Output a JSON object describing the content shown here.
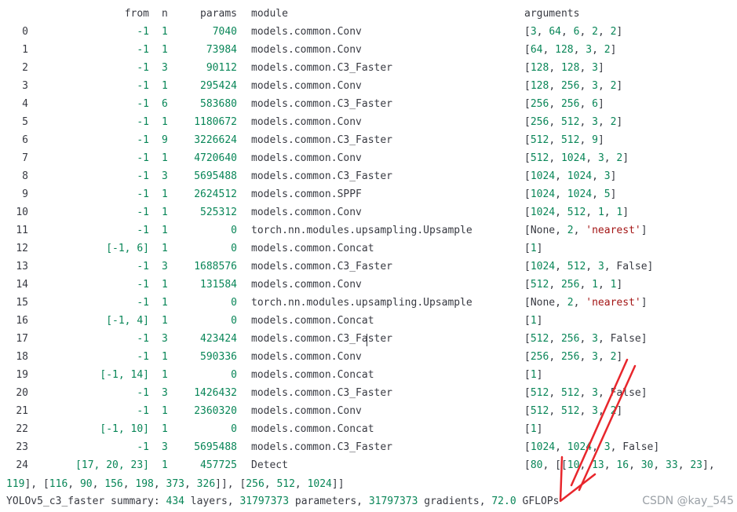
{
  "header": {
    "from": "from",
    "n": "n",
    "params": "params",
    "module": "module",
    "arguments": "arguments"
  },
  "rows": [
    {
      "idx": "0",
      "from": "-1",
      "n": "1",
      "params": "7040",
      "module": "models.common.Conv",
      "args": [
        [
          "[",
          "p"
        ],
        [
          "3",
          "n"
        ],
        [
          ", ",
          "p"
        ],
        [
          "64",
          "n"
        ],
        [
          ", ",
          "p"
        ],
        [
          "6",
          "n"
        ],
        [
          ", ",
          "p"
        ],
        [
          "2",
          "n"
        ],
        [
          ", ",
          "p"
        ],
        [
          "2",
          "n"
        ],
        [
          "]",
          "p"
        ]
      ]
    },
    {
      "idx": "1",
      "from": "-1",
      "n": "1",
      "params": "73984",
      "module": "models.common.Conv",
      "args": [
        [
          "[",
          "p"
        ],
        [
          "64",
          "n"
        ],
        [
          ", ",
          "p"
        ],
        [
          "128",
          "n"
        ],
        [
          ", ",
          "p"
        ],
        [
          "3",
          "n"
        ],
        [
          ", ",
          "p"
        ],
        [
          "2",
          "n"
        ],
        [
          "]",
          "p"
        ]
      ]
    },
    {
      "idx": "2",
      "from": "-1",
      "n": "3",
      "params": "90112",
      "module": "models.common.C3_Faster",
      "args": [
        [
          "[",
          "p"
        ],
        [
          "128",
          "n"
        ],
        [
          ", ",
          "p"
        ],
        [
          "128",
          "n"
        ],
        [
          ", ",
          "p"
        ],
        [
          "3",
          "n"
        ],
        [
          "]",
          "p"
        ]
      ]
    },
    {
      "idx": "3",
      "from": "-1",
      "n": "1",
      "params": "295424",
      "module": "models.common.Conv",
      "args": [
        [
          "[",
          "p"
        ],
        [
          "128",
          "n"
        ],
        [
          ", ",
          "p"
        ],
        [
          "256",
          "n"
        ],
        [
          ", ",
          "p"
        ],
        [
          "3",
          "n"
        ],
        [
          ", ",
          "p"
        ],
        [
          "2",
          "n"
        ],
        [
          "]",
          "p"
        ]
      ]
    },
    {
      "idx": "4",
      "from": "-1",
      "n": "6",
      "params": "583680",
      "module": "models.common.C3_Faster",
      "args": [
        [
          "[",
          "p"
        ],
        [
          "256",
          "n"
        ],
        [
          ", ",
          "p"
        ],
        [
          "256",
          "n"
        ],
        [
          ", ",
          "p"
        ],
        [
          "6",
          "n"
        ],
        [
          "]",
          "p"
        ]
      ]
    },
    {
      "idx": "5",
      "from": "-1",
      "n": "1",
      "params": "1180672",
      "module": "models.common.Conv",
      "args": [
        [
          "[",
          "p"
        ],
        [
          "256",
          "n"
        ],
        [
          ", ",
          "p"
        ],
        [
          "512",
          "n"
        ],
        [
          ", ",
          "p"
        ],
        [
          "3",
          "n"
        ],
        [
          ", ",
          "p"
        ],
        [
          "2",
          "n"
        ],
        [
          "]",
          "p"
        ]
      ]
    },
    {
      "idx": "6",
      "from": "-1",
      "n": "9",
      "params": "3226624",
      "module": "models.common.C3_Faster",
      "args": [
        [
          "[",
          "p"
        ],
        [
          "512",
          "n"
        ],
        [
          ", ",
          "p"
        ],
        [
          "512",
          "n"
        ],
        [
          ", ",
          "p"
        ],
        [
          "9",
          "n"
        ],
        [
          "]",
          "p"
        ]
      ]
    },
    {
      "idx": "7",
      "from": "-1",
      "n": "1",
      "params": "4720640",
      "module": "models.common.Conv",
      "args": [
        [
          "[",
          "p"
        ],
        [
          "512",
          "n"
        ],
        [
          ", ",
          "p"
        ],
        [
          "1024",
          "n"
        ],
        [
          ", ",
          "p"
        ],
        [
          "3",
          "n"
        ],
        [
          ", ",
          "p"
        ],
        [
          "2",
          "n"
        ],
        [
          "]",
          "p"
        ]
      ]
    },
    {
      "idx": "8",
      "from": "-1",
      "n": "3",
      "params": "5695488",
      "module": "models.common.C3_Faster",
      "args": [
        [
          "[",
          "p"
        ],
        [
          "1024",
          "n"
        ],
        [
          ", ",
          "p"
        ],
        [
          "1024",
          "n"
        ],
        [
          ", ",
          "p"
        ],
        [
          "3",
          "n"
        ],
        [
          "]",
          "p"
        ]
      ]
    },
    {
      "idx": "9",
      "from": "-1",
      "n": "1",
      "params": "2624512",
      "module": "models.common.SPPF",
      "args": [
        [
          "[",
          "p"
        ],
        [
          "1024",
          "n"
        ],
        [
          ", ",
          "p"
        ],
        [
          "1024",
          "n"
        ],
        [
          ", ",
          "p"
        ],
        [
          "5",
          "n"
        ],
        [
          "]",
          "p"
        ]
      ]
    },
    {
      "idx": "10",
      "from": "-1",
      "n": "1",
      "params": "525312",
      "module": "models.common.Conv",
      "args": [
        [
          "[",
          "p"
        ],
        [
          "1024",
          "n"
        ],
        [
          ", ",
          "p"
        ],
        [
          "512",
          "n"
        ],
        [
          ", ",
          "p"
        ],
        [
          "1",
          "n"
        ],
        [
          ", ",
          "p"
        ],
        [
          "1",
          "n"
        ],
        [
          "]",
          "p"
        ]
      ]
    },
    {
      "idx": "11",
      "from": "-1",
      "n": "1",
      "params": "0",
      "module": "torch.nn.modules.upsampling.Upsample",
      "args": [
        [
          "[None, ",
          "p"
        ],
        [
          "2",
          "n"
        ],
        [
          ", ",
          "p"
        ],
        [
          "'nearest'",
          "s"
        ],
        [
          "]",
          "p"
        ]
      ]
    },
    {
      "idx": "12",
      "from": "[-1, 6]",
      "n": "1",
      "params": "0",
      "module": "models.common.Concat",
      "args": [
        [
          "[",
          "p"
        ],
        [
          "1",
          "n"
        ],
        [
          "]",
          "p"
        ]
      ]
    },
    {
      "idx": "13",
      "from": "-1",
      "n": "3",
      "params": "1688576",
      "module": "models.common.C3_Faster",
      "args": [
        [
          "[",
          "p"
        ],
        [
          "1024",
          "n"
        ],
        [
          ", ",
          "p"
        ],
        [
          "512",
          "n"
        ],
        [
          ", ",
          "p"
        ],
        [
          "3",
          "n"
        ],
        [
          ", False]",
          "p"
        ]
      ]
    },
    {
      "idx": "14",
      "from": "-1",
      "n": "1",
      "params": "131584",
      "module": "models.common.Conv",
      "args": [
        [
          "[",
          "p"
        ],
        [
          "512",
          "n"
        ],
        [
          ", ",
          "p"
        ],
        [
          "256",
          "n"
        ],
        [
          ", ",
          "p"
        ],
        [
          "1",
          "n"
        ],
        [
          ", ",
          "p"
        ],
        [
          "1",
          "n"
        ],
        [
          "]",
          "p"
        ]
      ]
    },
    {
      "idx": "15",
      "from": "-1",
      "n": "1",
      "params": "0",
      "module": "torch.nn.modules.upsampling.Upsample",
      "args": [
        [
          "[None, ",
          "p"
        ],
        [
          "2",
          "n"
        ],
        [
          ", ",
          "p"
        ],
        [
          "'nearest'",
          "s"
        ],
        [
          "]",
          "p"
        ]
      ]
    },
    {
      "idx": "16",
      "from": "[-1, 4]",
      "n": "1",
      "params": "0",
      "module": "models.common.Concat",
      "args": [
        [
          "[",
          "p"
        ],
        [
          "1",
          "n"
        ],
        [
          "]",
          "p"
        ]
      ]
    },
    {
      "idx": "17",
      "from": "-1",
      "n": "3",
      "params": "423424",
      "module": "models.common.C3_Faster",
      "args": [
        [
          "[",
          "p"
        ],
        [
          "512",
          "n"
        ],
        [
          ", ",
          "p"
        ],
        [
          "256",
          "n"
        ],
        [
          ", ",
          "p"
        ],
        [
          "3",
          "n"
        ],
        [
          ", False]",
          "p"
        ]
      ]
    },
    {
      "idx": "18",
      "from": "-1",
      "n": "1",
      "params": "590336",
      "module": "models.common.Conv",
      "args": [
        [
          "[",
          "p"
        ],
        [
          "256",
          "n"
        ],
        [
          ", ",
          "p"
        ],
        [
          "256",
          "n"
        ],
        [
          ", ",
          "p"
        ],
        [
          "3",
          "n"
        ],
        [
          ", ",
          "p"
        ],
        [
          "2",
          "n"
        ],
        [
          "]",
          "p"
        ]
      ]
    },
    {
      "idx": "19",
      "from": "[-1, 14]",
      "n": "1",
      "params": "0",
      "module": "models.common.Concat",
      "args": [
        [
          "[",
          "p"
        ],
        [
          "1",
          "n"
        ],
        [
          "]",
          "p"
        ]
      ]
    },
    {
      "idx": "20",
      "from": "-1",
      "n": "3",
      "params": "1426432",
      "module": "models.common.C3_Faster",
      "args": [
        [
          "[",
          "p"
        ],
        [
          "512",
          "n"
        ],
        [
          ", ",
          "p"
        ],
        [
          "512",
          "n"
        ],
        [
          ", ",
          "p"
        ],
        [
          "3",
          "n"
        ],
        [
          ", False]",
          "p"
        ]
      ]
    },
    {
      "idx": "21",
      "from": "-1",
      "n": "1",
      "params": "2360320",
      "module": "models.common.Conv",
      "args": [
        [
          "[",
          "p"
        ],
        [
          "512",
          "n"
        ],
        [
          ", ",
          "p"
        ],
        [
          "512",
          "n"
        ],
        [
          ", ",
          "p"
        ],
        [
          "3",
          "n"
        ],
        [
          ", ",
          "p"
        ],
        [
          "2",
          "n"
        ],
        [
          "]",
          "p"
        ]
      ]
    },
    {
      "idx": "22",
      "from": "[-1, 10]",
      "n": "1",
      "params": "0",
      "module": "models.common.Concat",
      "args": [
        [
          "[",
          "p"
        ],
        [
          "1",
          "n"
        ],
        [
          "]",
          "p"
        ]
      ]
    },
    {
      "idx": "23",
      "from": "-1",
      "n": "3",
      "params": "5695488",
      "module": "models.common.C3_Faster",
      "args": [
        [
          "[",
          "p"
        ],
        [
          "1024",
          "n"
        ],
        [
          ", ",
          "p"
        ],
        [
          "1024",
          "n"
        ],
        [
          ", ",
          "p"
        ],
        [
          "3",
          "n"
        ],
        [
          ", False]",
          "p"
        ]
      ]
    },
    {
      "idx": "24",
      "from": "[17, 20, 23]",
      "n": "1",
      "params": "457725",
      "module": "Detect",
      "args": [
        [
          "[",
          "p"
        ],
        [
          "80",
          "n"
        ],
        [
          ", [[",
          "p"
        ],
        [
          "10",
          "n"
        ],
        [
          ", ",
          "p"
        ],
        [
          "13",
          "n"
        ],
        [
          ", ",
          "p"
        ],
        [
          "16",
          "n"
        ],
        [
          ", ",
          "p"
        ],
        [
          "30",
          "n"
        ],
        [
          ", ",
          "p"
        ],
        [
          "33",
          "n"
        ],
        [
          ", ",
          "p"
        ],
        [
          "23",
          "n"
        ],
        [
          "],",
          "p"
        ]
      ]
    }
  ],
  "wrap_line": [
    [
      "119",
      "n"
    ],
    [
      "], [",
      "p"
    ],
    [
      "116",
      "n"
    ],
    [
      ", ",
      "p"
    ],
    [
      "90",
      "n"
    ],
    [
      ", ",
      "p"
    ],
    [
      "156",
      "n"
    ],
    [
      ", ",
      "p"
    ],
    [
      "198",
      "n"
    ],
    [
      ", ",
      "p"
    ],
    [
      "373",
      "n"
    ],
    [
      ", ",
      "p"
    ],
    [
      "326",
      "n"
    ],
    [
      "]], [",
      "p"
    ],
    [
      "256",
      "n"
    ],
    [
      ", ",
      "p"
    ],
    [
      "512",
      "n"
    ],
    [
      ", ",
      "p"
    ],
    [
      "1024",
      "n"
    ],
    [
      "]]",
      "p"
    ]
  ],
  "summary": [
    [
      "YOLOv5_c3_faster summary: ",
      "p"
    ],
    [
      "434",
      "n"
    ],
    [
      " layers, ",
      "p"
    ],
    [
      "31797373",
      "n"
    ],
    [
      " parameters, ",
      "p"
    ],
    [
      "31797373",
      "n"
    ],
    [
      " gradients, ",
      "p"
    ],
    [
      "72.0",
      "n"
    ],
    [
      " GFLOPs",
      "p"
    ]
  ],
  "watermark": "CSDN @kay_545",
  "colors": {
    "text": "#383a42",
    "number": "#098658",
    "string": "#a31515",
    "annotation_arrow": "#e8262c"
  },
  "annotation": {
    "shape": "red-arrow",
    "points_to": "72.0 GFLOPs"
  }
}
